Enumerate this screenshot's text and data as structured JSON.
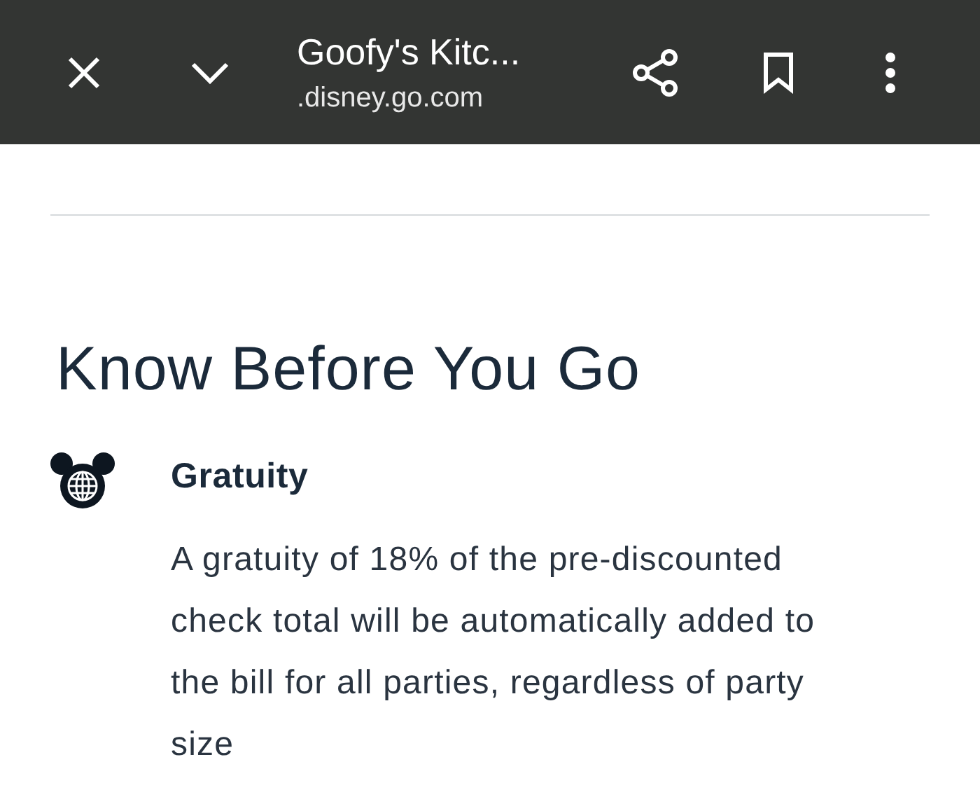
{
  "toolbar": {
    "title": "Goofy's Kitc...",
    "url": ".disney.go.com"
  },
  "section": {
    "heading": "Know Before You Go"
  },
  "items": [
    {
      "title": "Gratuity",
      "lines": [
        "A gratuity of 18% of the pre-discounted",
        "check total will be automatically added to",
        "the bill for all parties, regardless of party",
        "size"
      ]
    }
  ]
}
